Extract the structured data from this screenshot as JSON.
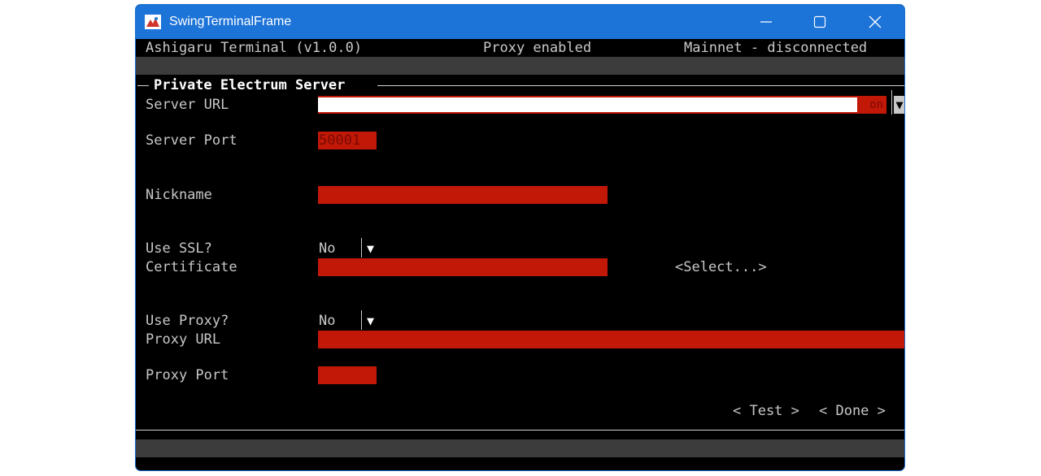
{
  "window": {
    "title": "SwingTerminalFrame"
  },
  "status": {
    "app_name": "Ashigaru Terminal (v1.0.0)",
    "proxy": "Proxy enabled",
    "network": "Mainnet - disconnected"
  },
  "panel": {
    "title": "Private Electrum Server"
  },
  "form": {
    "server_url_label": "Server URL",
    "server_url_value": "",
    "server_url_tail": "on",
    "server_port_label": "Server Port",
    "server_port_value": "50001",
    "nickname_label": "Nickname",
    "nickname_value": "",
    "use_ssl_label": "Use SSL?",
    "use_ssl_value": "No",
    "certificate_label": "Certificate",
    "certificate_value": "",
    "select_button": "<Select...>",
    "use_proxy_label": "Use Proxy?",
    "use_proxy_value": "No",
    "proxy_url_label": "Proxy URL",
    "proxy_url_value": "",
    "proxy_port_label": "Proxy Port",
    "proxy_port_value": ""
  },
  "buttons": {
    "test": "< Test >",
    "done": "< Done >"
  },
  "icons": {
    "dropdown": "▼"
  },
  "colors": {
    "titlebar": "#1c73d8",
    "field": "#c21807",
    "background": "#000000",
    "text": "#c8c8c8"
  }
}
